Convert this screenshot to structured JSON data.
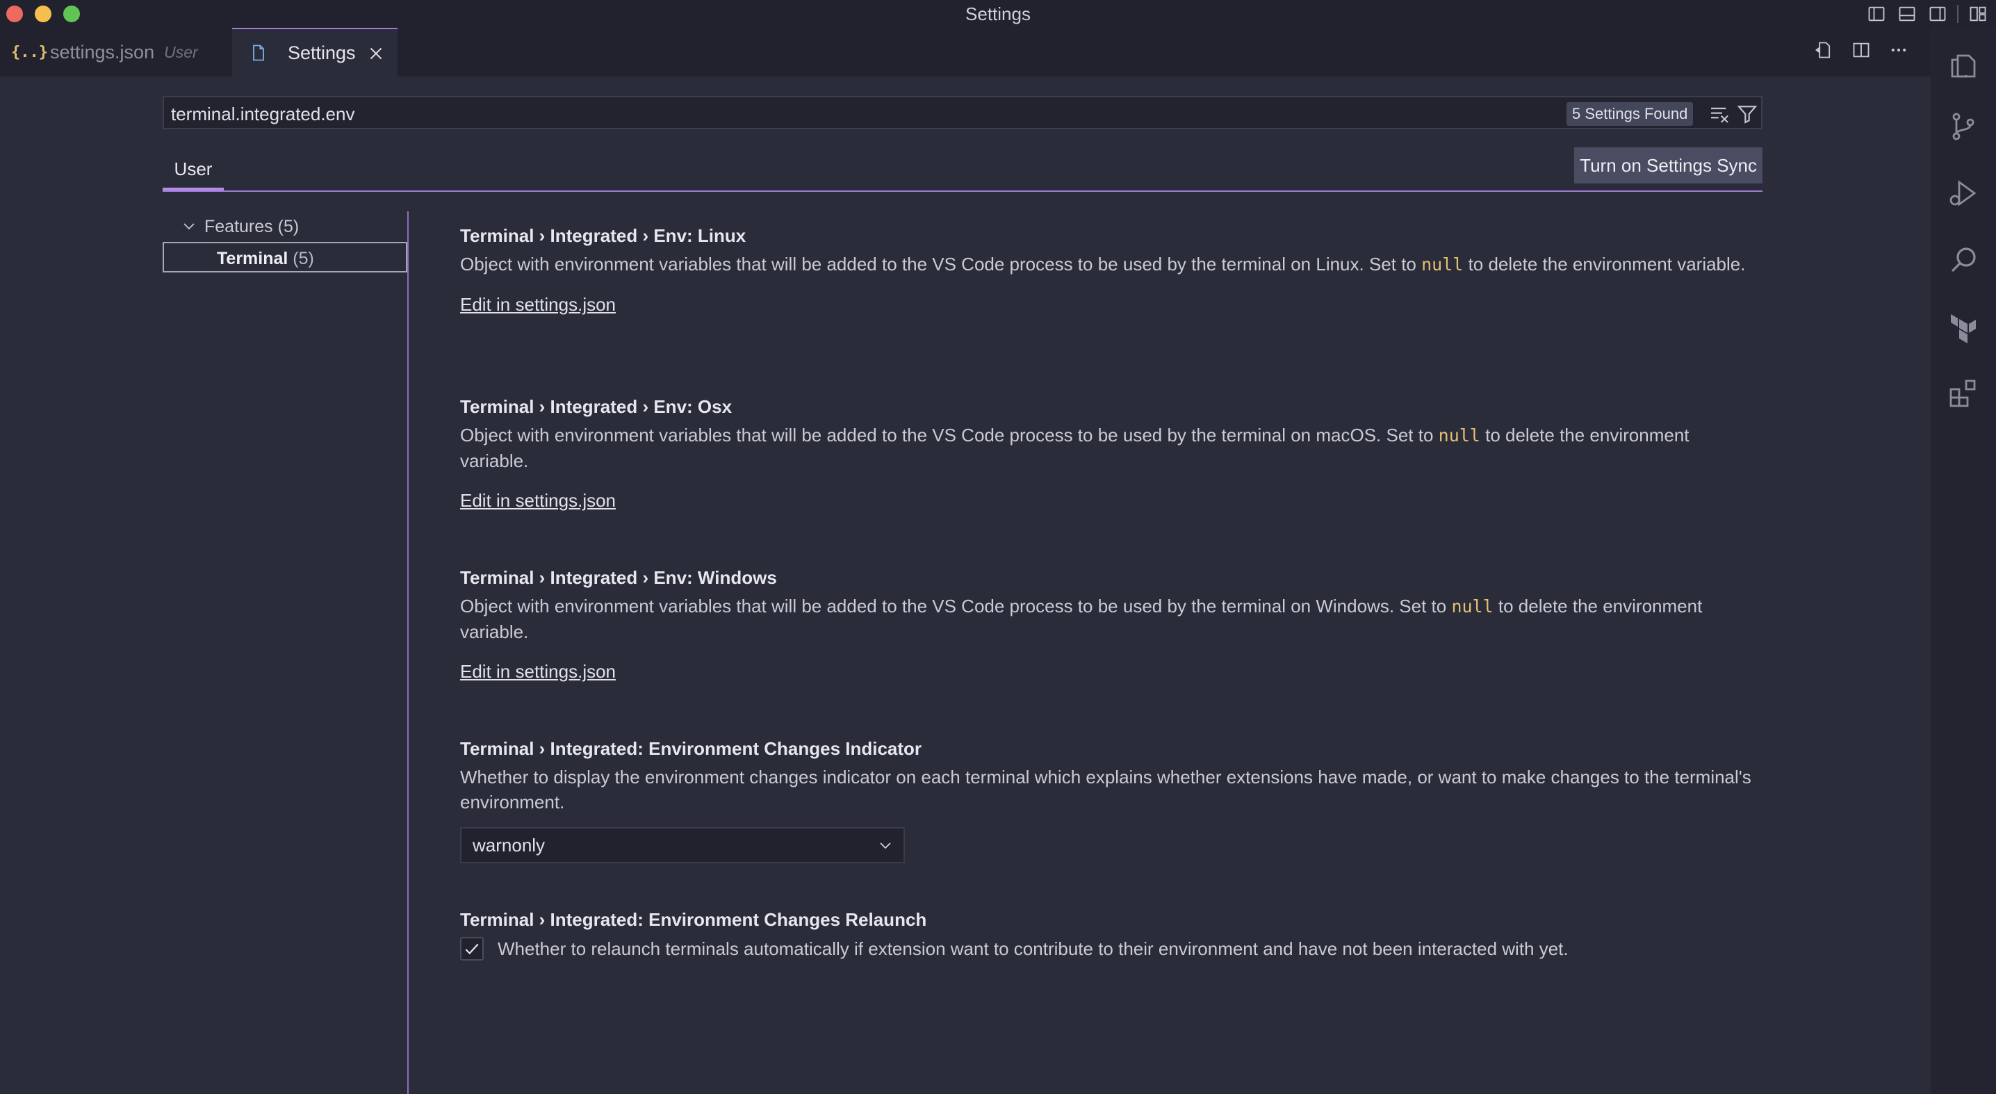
{
  "window": {
    "title": "Settings"
  },
  "tabs": [
    {
      "label": "settings.json",
      "description": "User",
      "icon": "json-braces-icon",
      "active": false
    },
    {
      "label": "Settings",
      "icon": "file-icon",
      "active": true
    }
  ],
  "search": {
    "value": "terminal.integrated.env",
    "results_count": "5 Settings Found"
  },
  "scope": {
    "tab_label": "User",
    "sync_button_label": "Turn on Settings Sync"
  },
  "toc": {
    "features_label": "Features",
    "features_count": "(5)",
    "terminal_label": "Terminal",
    "terminal_count": "(5)"
  },
  "settings": [
    {
      "category": "Terminal › Integrated › ",
      "name": "Env: Linux",
      "desc_before": "Object with environment variables that will be added to the VS Code process to be used by the terminal on Linux. Set to ",
      "code": "null",
      "desc_after": " to delete the environment variable.",
      "link": "Edit in settings.json"
    },
    {
      "category": "Terminal › Integrated › ",
      "name": "Env: Osx",
      "desc_before": "Object with environment variables that will be added to the VS Code process to be used by the terminal on macOS. Set to ",
      "code": "null",
      "desc_after": " to delete the environment variable.",
      "link": "Edit in settings.json"
    },
    {
      "category": "Terminal › Integrated › ",
      "name": "Env: Windows",
      "desc_before": "Object with environment variables that will be added to the VS Code process to be used by the terminal on Windows. Set to ",
      "code": "null",
      "desc_after": " to delete the environment variable.",
      "link": "Edit in settings.json"
    },
    {
      "category": "Terminal › Integrated: ",
      "name": "Environment Changes Indicator",
      "description": "Whether to display the environment changes indicator on each terminal which explains whether extensions have made, or want to make changes to the terminal's environment.",
      "select_value": "warnonly"
    },
    {
      "category": "Terminal › Integrated: ",
      "name": "Environment Changes Relaunch",
      "checkbox_label": "Whether to relaunch terminals automatically if extension want to contribute to their environment and have not been interacted with yet.",
      "checked": true
    }
  ],
  "colors": {
    "accent": "#a27ad8",
    "code": "#e3c06f",
    "background": "#2a2c3a"
  }
}
